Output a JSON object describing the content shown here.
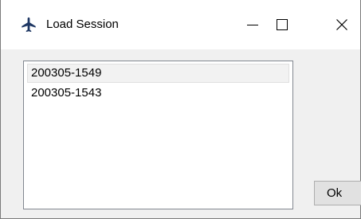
{
  "window": {
    "title": "Load Session",
    "icon": "airplane-icon",
    "controls": {
      "minimize": "minimize-icon",
      "maximize": "maximize-icon",
      "close": "close-icon"
    }
  },
  "sessions": {
    "items": [
      {
        "label": "200305-1549",
        "selected": true
      },
      {
        "label": "200305-1543",
        "selected": false
      }
    ]
  },
  "buttons": {
    "ok_label": "Ok"
  },
  "colors": {
    "titlebar": "#ffffff",
    "body": "#f0f0f0",
    "icon": "#1f3864",
    "selection": "#f2f2f2"
  }
}
